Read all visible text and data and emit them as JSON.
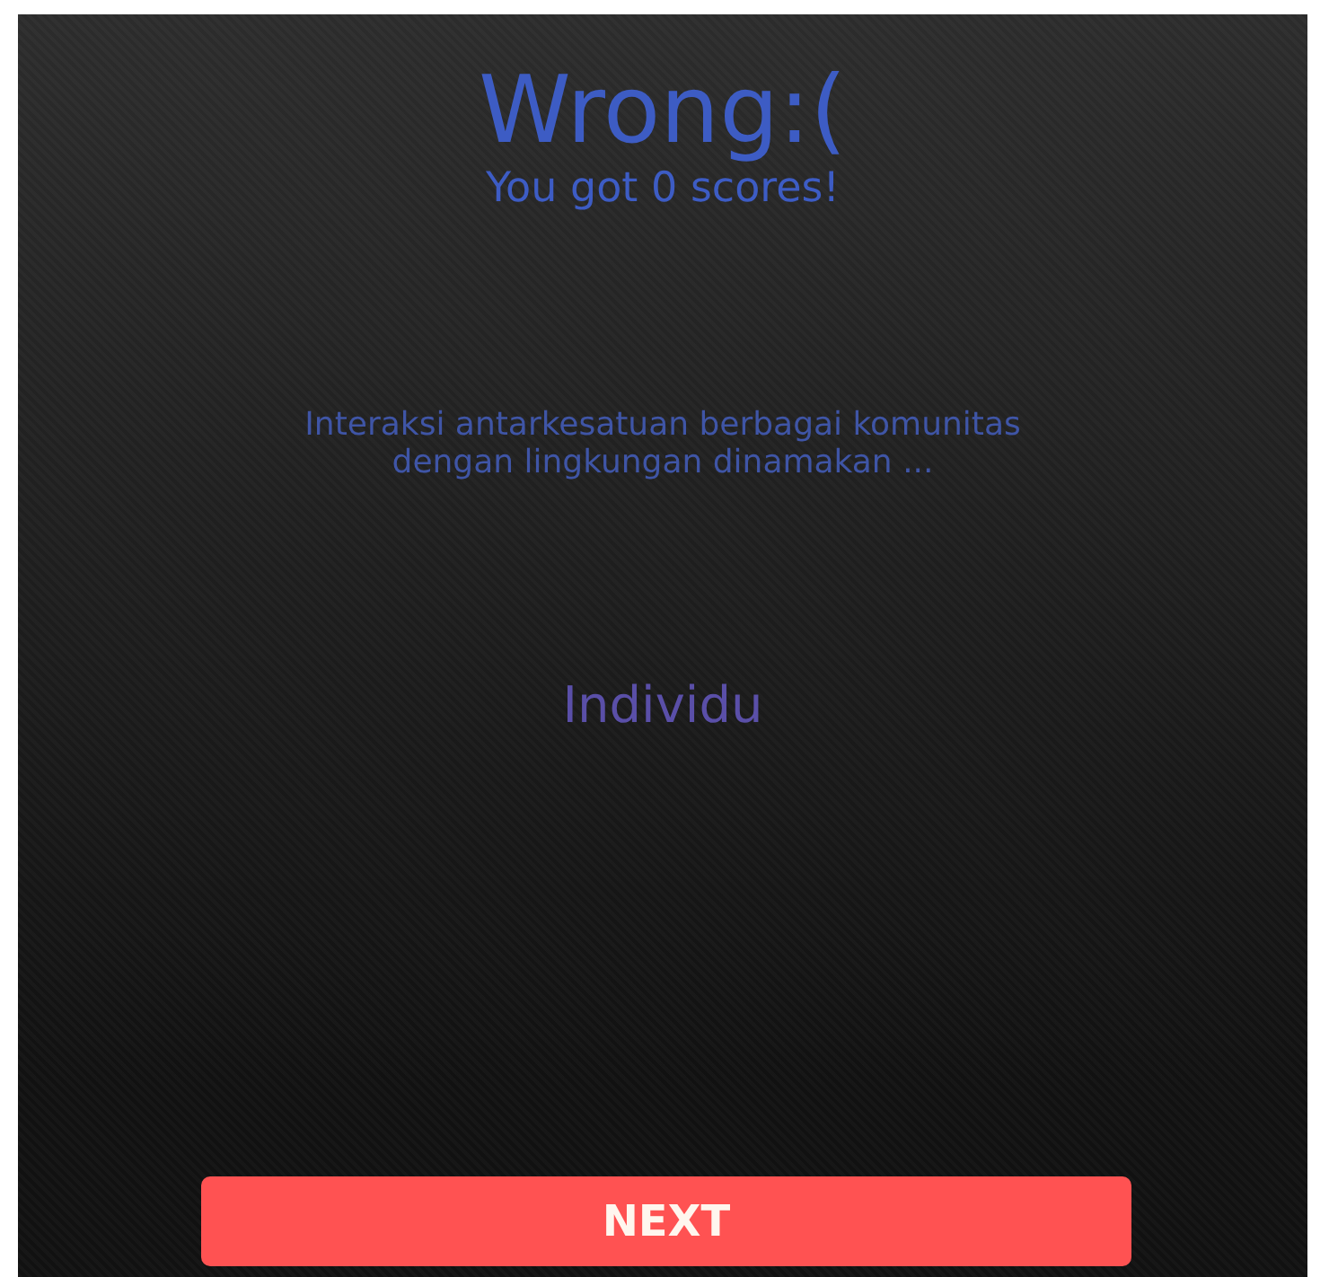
{
  "result": {
    "title": "Wrong:(",
    "score_message": "You got 0 scores!"
  },
  "question": "Interaksi antarkesatuan berbagai komunitas dengan lingkungan dinamakan ...",
  "answer": "Individu",
  "next_button": "NEXT"
}
